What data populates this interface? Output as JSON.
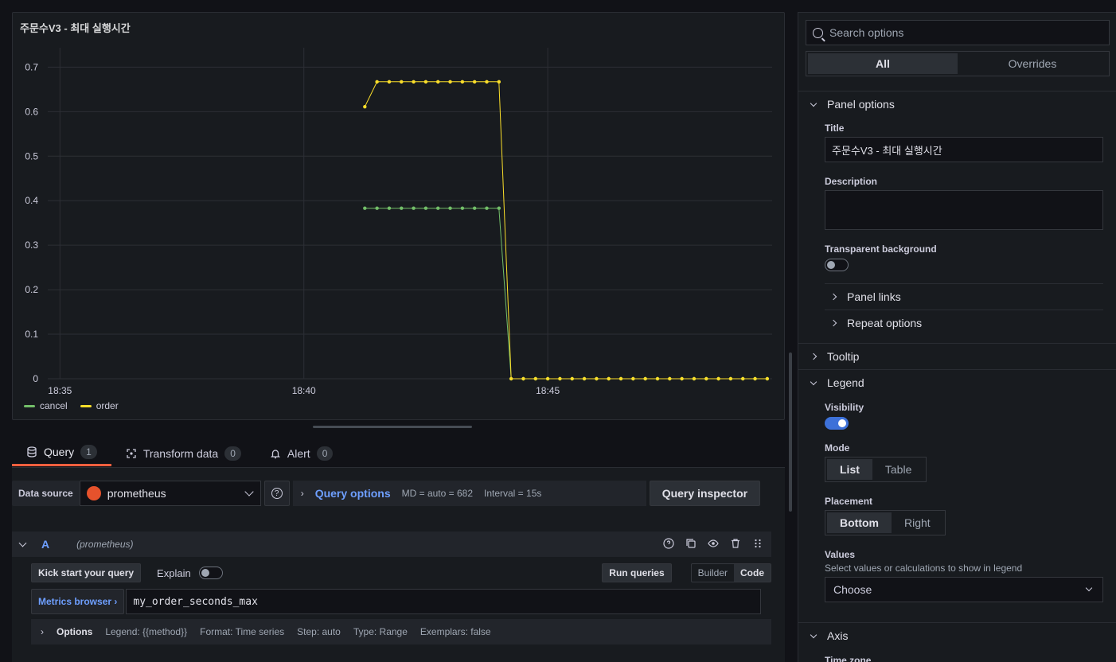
{
  "panel": {
    "title": "주문수V3 - 최대 실행시간"
  },
  "chart_data": {
    "type": "line",
    "x_ticks": [
      "18:35",
      "18:40",
      "18:45"
    ],
    "x_tick_values": [
      0,
      5,
      10
    ],
    "xlim": [
      -0.25,
      14.6
    ],
    "ylim": [
      0,
      0.74
    ],
    "y_ticks": [
      0,
      0.1,
      0.2,
      0.3,
      0.4,
      0.5,
      0.6,
      0.7
    ],
    "grid": true,
    "legend_placement": "bottom-left",
    "series": [
      {
        "name": "cancel",
        "color": "#73bf69",
        "x": [
          6.25,
          6.5,
          6.75,
          7.0,
          7.25,
          7.5,
          7.75,
          8.0,
          8.25,
          8.5,
          8.75,
          9.0,
          9.25,
          9.5,
          9.75,
          10.0,
          10.25,
          10.5,
          10.75,
          11.0,
          11.25,
          11.5,
          11.75,
          12.0,
          12.25,
          12.5,
          12.75,
          13.0,
          13.25,
          13.5,
          13.75,
          14.0,
          14.25,
          14.5
        ],
        "y": [
          0.383,
          0.383,
          0.383,
          0.383,
          0.383,
          0.383,
          0.383,
          0.383,
          0.383,
          0.383,
          0.383,
          0.383,
          0.0,
          0.0,
          0.0,
          0.0,
          0.0,
          0.0,
          0.0,
          0.0,
          0.0,
          0.0,
          0.0,
          0.0,
          0.0,
          0.0,
          0.0,
          0.0,
          0.0,
          0.0,
          0.0,
          0.0,
          0.0,
          0.0
        ]
      },
      {
        "name": "order",
        "color": "#fade2a",
        "x": [
          6.25,
          6.5,
          6.75,
          7.0,
          7.25,
          7.5,
          7.75,
          8.0,
          8.25,
          8.5,
          8.75,
          9.0,
          9.25,
          9.5,
          9.75,
          10.0,
          10.25,
          10.5,
          10.75,
          11.0,
          11.25,
          11.5,
          11.75,
          12.0,
          12.25,
          12.5,
          12.75,
          13.0,
          13.25,
          13.5,
          13.75,
          14.0,
          14.25,
          14.5
        ],
        "y": [
          0.611,
          0.667,
          0.667,
          0.667,
          0.667,
          0.667,
          0.667,
          0.667,
          0.667,
          0.667,
          0.667,
          0.667,
          0.0,
          0.0,
          0.0,
          0.0,
          0.0,
          0.0,
          0.0,
          0.0,
          0.0,
          0.0,
          0.0,
          0.0,
          0.0,
          0.0,
          0.0,
          0.0,
          0.0,
          0.0,
          0.0,
          0.0,
          0.0,
          0.0
        ]
      }
    ]
  },
  "legend": [
    {
      "label": "cancel",
      "color": "#73bf69"
    },
    {
      "label": "order",
      "color": "#fade2a"
    }
  ],
  "tabs": [
    {
      "label": "Query",
      "count": "1",
      "icon": "database-icon"
    },
    {
      "label": "Transform data",
      "count": "0",
      "icon": "transform-icon"
    },
    {
      "label": "Alert",
      "count": "0",
      "icon": "bell-icon"
    }
  ],
  "query": {
    "ds_label": "Data source",
    "ds_name": "prometheus",
    "options_link": "Query options",
    "md": "MD = auto = 682",
    "interval": "Interval = 15s",
    "inspector": "Query inspector",
    "row_letter": "A",
    "row_ds": "(prometheus)",
    "kick_start": "Kick start your query",
    "explain": "Explain",
    "run": "Run queries",
    "builder": "Builder",
    "code": "Code",
    "metrics_browser": "Metrics browser ›",
    "expr": "my_order_seconds_max",
    "options_label": "Options",
    "opt_legend": "Legend: {{method}}",
    "opt_format": "Format: Time series",
    "opt_step": "Step: auto",
    "opt_type": "Type: Range",
    "opt_exemplars": "Exemplars: false"
  },
  "options": {
    "search_placeholder": "Search options",
    "seg_all": "All",
    "seg_overrides": "Overrides",
    "panel_options": "Panel options",
    "title_label": "Title",
    "title_value": "주문수V3 - 최대 실행시간",
    "description_label": "Description",
    "transparent_label": "Transparent background",
    "panel_links": "Panel links",
    "repeat_options": "Repeat options",
    "tooltip": "Tooltip",
    "legend": "Legend",
    "visibility_label": "Visibility",
    "mode_label": "Mode",
    "mode_list": "List",
    "mode_table": "Table",
    "placement_label": "Placement",
    "placement_bottom": "Bottom",
    "placement_right": "Right",
    "values_label": "Values",
    "values_desc": "Select values or calculations to show in legend",
    "values_placeholder": "Choose",
    "axis": "Axis",
    "timezone_label": "Time zone"
  }
}
